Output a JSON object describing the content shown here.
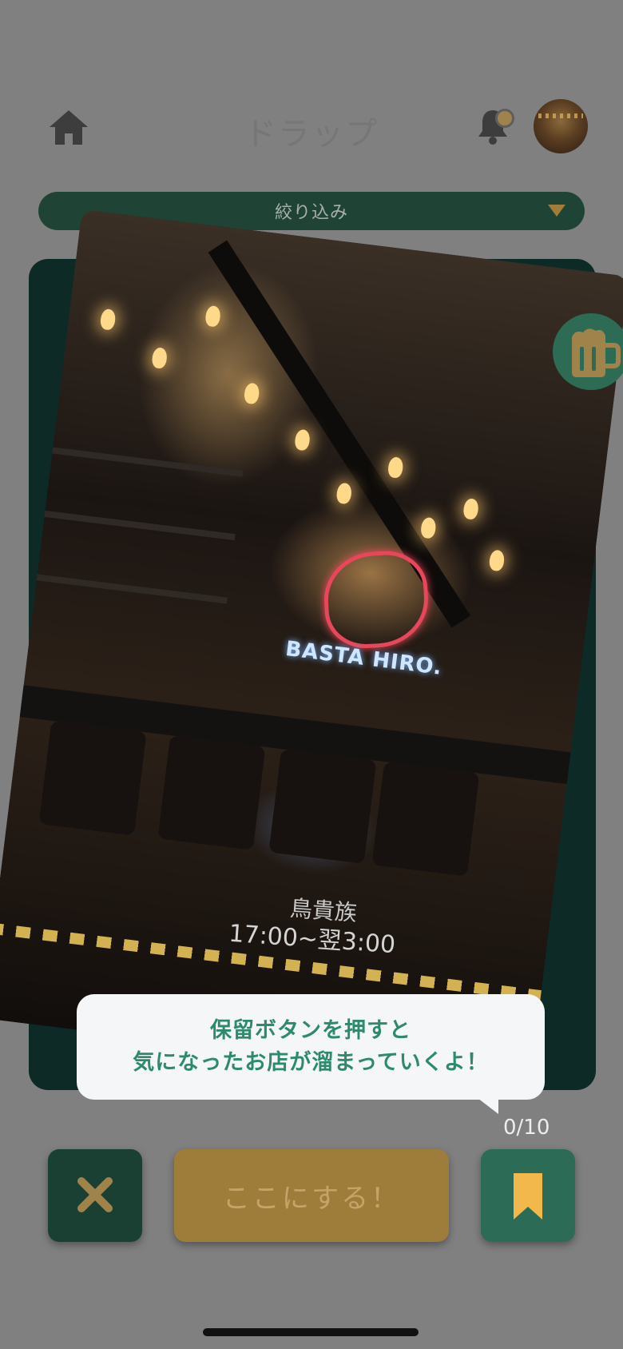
{
  "header": {
    "title": "ドラップ",
    "home_icon": "home-icon",
    "bell_icon": "bell-icon",
    "avatar": "avatar"
  },
  "filter": {
    "label": "絞り込み",
    "caret_icon": "caret-down-icon"
  },
  "card": {
    "shop_name": "鳥貴族",
    "hours": "17:00~翌3:00",
    "badge_icon": "beer-mug-icon",
    "sign_text": "BASTA HIRO."
  },
  "tip": {
    "line1": "保留ボタンを押すと",
    "line2": "気になったお店が溜まっていくよ！"
  },
  "hold_counter": "0/10",
  "actions": {
    "close_icon": "close-icon",
    "decide_label": "ここにする！",
    "hold_icon": "bookmark-icon"
  },
  "colors": {
    "overlay": "#808080",
    "primary_green": "#1f4435",
    "accent_gold": "#f2b84b",
    "tip_text": "#2e8a6d"
  }
}
